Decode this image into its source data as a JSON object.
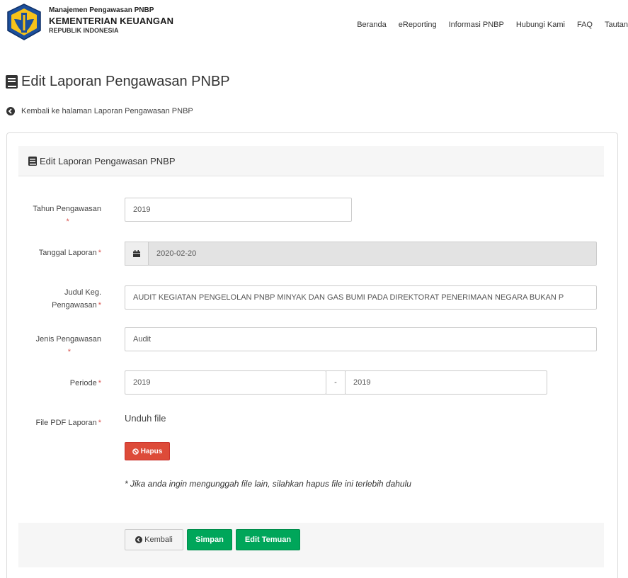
{
  "header": {
    "app_name": "Manajemen Pengawasan PNBP",
    "org_name": "KEMENTERIAN KEUANGAN",
    "country": "REPUBLIK INDONESIA",
    "nav": [
      "Beranda",
      "eReporting",
      "Informasi PNBP",
      "Hubungi Kami",
      "FAQ",
      "Tautan"
    ]
  },
  "page": {
    "title": "Edit Laporan Pengawasan PNBP",
    "back_link": "Kembali ke halaman Laporan Pengawasan PNBP",
    "card_title": "Edit Laporan Pengawasan PNBP"
  },
  "form": {
    "tahun": {
      "label_line1": "Tahun Pengawasan",
      "star": "*",
      "value": "2019"
    },
    "tanggal": {
      "label": "Tanggal Laporan",
      "star": "*",
      "value": "2020-02-20"
    },
    "judul": {
      "label_line1": "Judul Keg.",
      "label_line2": "Pengawasan",
      "star": "*",
      "value": "AUDIT KEGIATAN PENGELOLAN PNBP MINYAK DAN GAS BUMI PADA DIREKTORAT PENERIMAAN NEGARA BUKAN P"
    },
    "jenis": {
      "label_line1": "Jenis Pengawasan",
      "star": "*",
      "value": "Audit"
    },
    "periode": {
      "label": "Periode",
      "star": "*",
      "from": "2019",
      "separator": "-",
      "to": "2019"
    },
    "file": {
      "label": "File PDF Laporan",
      "star": "*",
      "link": "Unduh file",
      "delete_button": "Hapus",
      "note": "* Jika anda ingin mengunggah file lain, silahkan hapus file ini terlebih dahulu"
    }
  },
  "buttons": {
    "back": "Kembali",
    "save": "Simpan",
    "edit_findings": "Edit Temuan"
  },
  "colors": {
    "danger": "#dd4b39",
    "success": "#00a65a",
    "star": "#d9534f"
  },
  "icons": {
    "title": "book-icon",
    "back": "chevron-circle-left-icon",
    "calendar": "calendar-icon",
    "delete": "ban-icon"
  }
}
